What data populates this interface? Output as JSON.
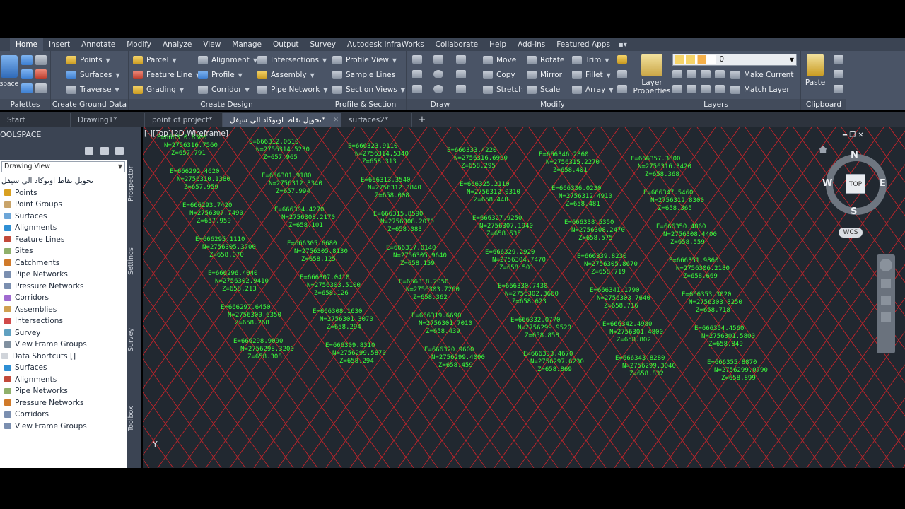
{
  "ribbon_tabs": [
    "Home",
    "Insert",
    "Annotate",
    "Modify",
    "Analyze",
    "View",
    "Manage",
    "Output",
    "Survey",
    "Autodesk InfraWorks",
    "Collaborate",
    "Help",
    "Add-ins",
    "Featured Apps"
  ],
  "toolspace_btn": "Toolspace",
  "panels": {
    "palettes": "Palettes",
    "ground": {
      "title": "Create Ground Data",
      "points": "Points",
      "surfaces": "Surfaces",
      "traverse": "Traverse"
    },
    "design": {
      "title": "Create Design",
      "parcel": "Parcel",
      "feature_line": "Feature Line",
      "grading": "Grading",
      "alignment": "Alignment",
      "profile": "Profile",
      "corridor": "Corridor",
      "intersections": "Intersections",
      "assembly": "Assembly",
      "pipe_network": "Pipe Network"
    },
    "profile_views": {
      "title": "Profile & Section Views",
      "profile_view": "Profile View",
      "sample_lines": "Sample Lines",
      "section_views": "Section Views"
    },
    "draw": {
      "title": "Draw"
    },
    "modify": {
      "title": "Modify",
      "move": "Move",
      "rotate": "Rotate",
      "trim": "Trim",
      "copy": "Copy",
      "mirror": "Mirror",
      "fillet": "Fillet",
      "stretch": "Stretch",
      "scale": "Scale",
      "array": "Array"
    },
    "layers": {
      "title": "Layers",
      "layer_properties": "Layer Properties",
      "layer_value": "0",
      "make_current": "Make Current",
      "match_layer": "Match Layer"
    },
    "clipboard": {
      "title": "Clipboard",
      "paste": "Paste"
    }
  },
  "doc_tabs": [
    "Start",
    "Drawing1*",
    "point of project*",
    "تحويل نقاط اوتوكاد الى سيفل*",
    "surfaces2*"
  ],
  "toolspace": {
    "title": "OOLSPACE",
    "view_select": "Drawing View",
    "prospector_items": [
      "تحويل نقاط اوتوكاد الى سيفل",
      "Points",
      "Point Groups",
      "Surfaces",
      "Alignments",
      "Feature Lines",
      "Sites",
      "Catchments",
      "Pipe Networks",
      "Pressure Networks",
      "Corridors",
      "Assemblies",
      "Intersections",
      "Survey",
      "View Frame Groups"
    ],
    "shortcuts": [
      "Data Shortcuts []",
      "Surfaces",
      "Alignments",
      "Pipe Networks",
      "Pressure Networks",
      "Corridors",
      "View Frame Groups"
    ],
    "side_tabs": [
      "Prospector",
      "Settings",
      "Survey",
      "Toolbox"
    ]
  },
  "viewport": {
    "label": "[-][Top][2D Wireframe]",
    "viewcube_face": "TOP",
    "compass": {
      "n": "N",
      "s": "S",
      "e": "E",
      "w": "W"
    },
    "wcs": "WCS",
    "y_axis": "Y"
  },
  "points": [
    {
      "e": "E=666310.8300",
      "n": "N=2756316.7560",
      "z": "Z=657.791"
    },
    {
      "e": "E=666312.0610",
      "n": "N=2756314.5230",
      "z": "Z=657.965"
    },
    {
      "e": "E=666323.9110",
      "n": "N=2756314.5340",
      "z": "Z=658.313"
    },
    {
      "e": "E=666333.4220",
      "n": "N=2756316.6990",
      "z": "Z=658.295"
    },
    {
      "e": "E=666346.2860",
      "n": "N=2756315.2270",
      "z": "Z=658.401"
    },
    {
      "e": "E=666357.3800",
      "n": "N=2756316.3420",
      "z": "Z=658.368"
    },
    {
      "e": "E=666292.4620",
      "n": "N=2756310.1380",
      "z": "Z=657.959"
    },
    {
      "e": "E=666301.9180",
      "n": "N=2756312.8340",
      "z": "Z=657.994"
    },
    {
      "e": "E=666313.3540",
      "n": "N=2756312.3840",
      "z": "Z=658.008"
    },
    {
      "e": "E=666325.2110",
      "n": "N=2756312.0310",
      "z": "Z=658.448"
    },
    {
      "e": "E=666336.0230",
      "n": "N=2756312.4910",
      "z": "Z=658.481"
    },
    {
      "e": "E=666347.5460",
      "n": "N=2756312.8300",
      "z": "Z=658.365"
    },
    {
      "e": "E=666293.7420",
      "n": "N=2756307.7490",
      "z": "Z=657.959"
    },
    {
      "e": "E=666304.4270",
      "n": "N=2756308.2170",
      "z": "Z=658.101"
    },
    {
      "e": "E=666315.8590",
      "n": "N=2756308.2070",
      "z": "Z=658.083"
    },
    {
      "e": "E=666327.9250",
      "n": "N=2756307.1940",
      "z": "Z=658.535"
    },
    {
      "e": "E=666338.5350",
      "n": "N=2756308.2470",
      "z": "Z=658.575"
    },
    {
      "e": "E=666350.4860",
      "n": "N=2756308.4400",
      "z": "Z=658.559"
    },
    {
      "e": "E=666295.1110",
      "n": "N=2756305.3700",
      "z": "Z=658.070"
    },
    {
      "e": "E=666305.6680",
      "n": "N=2756305.8130",
      "z": "Z=658.125"
    },
    {
      "e": "E=666317.0140",
      "n": "N=2756305.9640",
      "z": "Z=658.159"
    },
    {
      "e": "E=666329.2920",
      "n": "N=2756304.7470",
      "z": "Z=658.501"
    },
    {
      "e": "E=666339.8230",
      "n": "N=2756305.8670",
      "z": "Z=658.719"
    },
    {
      "e": "E=666351.9860",
      "n": "N=2756306.2180",
      "z": "Z=658.669"
    },
    {
      "e": "E=666296.4040",
      "n": "N=2756302.9410",
      "z": "Z=658.213"
    },
    {
      "e": "E=666307.0410",
      "n": "N=2756303.5100",
      "z": "Z=658.126"
    },
    {
      "e": "E=666318.2050",
      "n": "N=2756303.7260",
      "z": "Z=658.362"
    },
    {
      "e": "E=666330.7430",
      "n": "N=2756302.3660",
      "z": "Z=658.623"
    },
    {
      "e": "E=666341.1790",
      "n": "N=2756303.7640",
      "z": "Z=658.716"
    },
    {
      "e": "E=666353.3020",
      "n": "N=2756303.8250",
      "z": "Z=658.718"
    },
    {
      "e": "E=666297.6450",
      "n": "N=2756300.6350",
      "z": "Z=658.268"
    },
    {
      "e": "E=666308.1630",
      "n": "N=2756301.3070",
      "z": "Z=658.294"
    },
    {
      "e": "E=666319.6690",
      "n": "N=2756301.7010",
      "z": "Z=658.439"
    },
    {
      "e": "E=666332.0770",
      "n": "N=2756299.9520",
      "z": "Z=658.858"
    },
    {
      "e": "E=666342.4980",
      "n": "N=2756301.4800",
      "z": "Z=658.802"
    },
    {
      "e": "E=666354.4560",
      "n": "N=2756301.5800",
      "z": "Z=658.849"
    },
    {
      "e": "E=666298.9090",
      "n": "N=2756298.3200",
      "z": "Z=658.308"
    },
    {
      "e": "E=666309.8310",
      "n": "N=2756299.5870",
      "z": "Z=658.294"
    },
    {
      "e": "E=666320.9600",
      "n": "N=2756299.4090",
      "z": "Z=658.459"
    },
    {
      "e": "E=666333.4670",
      "n": "N=2756297.6230",
      "z": "Z=658.869"
    },
    {
      "e": "E=666343.8280",
      "n": "N=2756299.3040",
      "z": "Z=658.832"
    },
    {
      "e": "E=666355.8870",
      "n": "N=2756299.0790",
      "z": "Z=658.899"
    }
  ],
  "colors": {
    "ribbon": "#4a5466",
    "tabs": "#3b4453",
    "canvas": "#212830",
    "points": "#3cff3c",
    "grid": "#e0242a"
  }
}
